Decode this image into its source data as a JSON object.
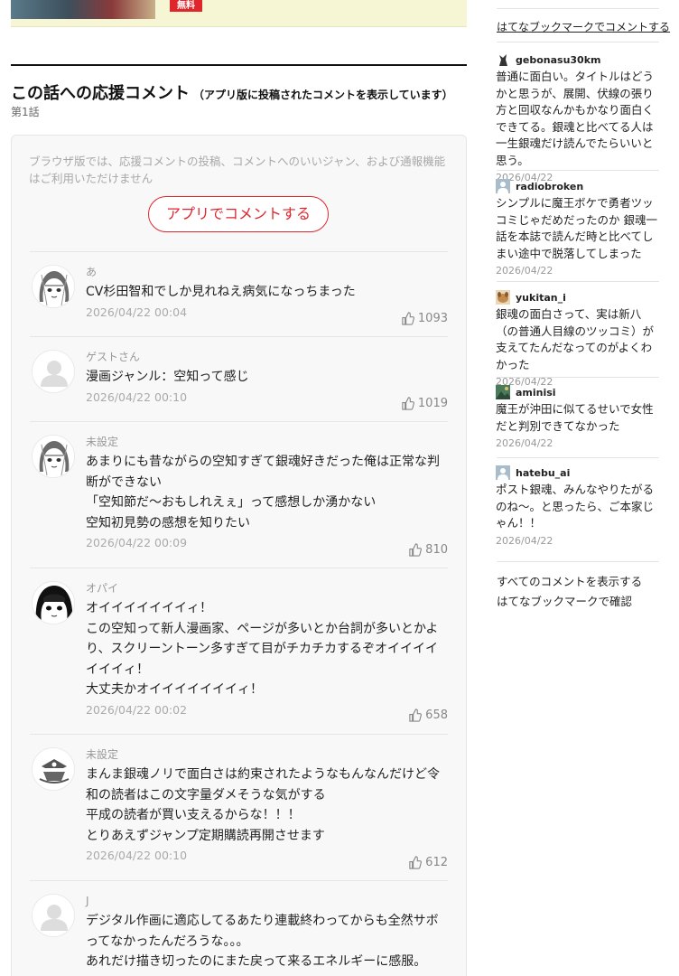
{
  "banner": {
    "free_label": "無料"
  },
  "section": {
    "title": "この話への応援コメント",
    "subtitle": "（アプリ版に投稿されたコメントを表示しています）",
    "episode": "第1話"
  },
  "notice": "ブラウザ版では、応援コメントの投稿、コメントへのいいジャン、および通報機能はご利用いただけません",
  "app_button_label": "アプリでコメントする",
  "comments": [
    {
      "name": "あ",
      "lines": [
        "CV杉田智和でしか見れねえ病気になっちまった"
      ],
      "date": "2026/04/22 00:04",
      "likes": "1093",
      "avatar": "manga-girl-avatar"
    },
    {
      "name": "ゲストさん",
      "lines": [
        "漫画ジャンル：空知って感じ"
      ],
      "date": "2026/04/22 00:10",
      "likes": "1019",
      "avatar": "default-user-avatar"
    },
    {
      "name": "未設定",
      "lines": [
        "あまりにも昔ながらの空知すぎて銀魂好きだった俺は正常な判",
        "断ができない",
        "「空知節だ～おもしれえぇ」って感想しか湧かない",
        "空知初見勢の感想を知りたい"
      ],
      "date": "2026/04/22 00:09",
      "likes": "810",
      "avatar": "manga-girl-avatar"
    },
    {
      "name": "オパイ",
      "lines": [
        "オイイイイイイイィ！",
        "この空知って新人漫画家、ページが多いとか台詞が多いとかよ",
        "り、スクリーントーン多すぎて目がチカチカするぞオイイイイ",
        "イイイィ！",
        "大丈夫かオイイイイイイイィ！"
      ],
      "date": "2026/04/22 00:02",
      "likes": "658",
      "avatar": "manga-dark-hair-avatar"
    },
    {
      "name": "未設定",
      "lines": [
        "まんま銀魂ノリで面白さは約束されたようなもんなんだけど令",
        "和の読者はこの文字量ダメそうな気がする",
        "平成の読者が買い支えるからな！！！",
        "とりあえずジャンプ定期購読再開させます"
      ],
      "date": "2026/04/22 00:10",
      "likes": "612",
      "avatar": "pirate-ship-avatar"
    },
    {
      "name": "J",
      "lines": [
        "デジタル作画に適応してるあたり連載終わってからも全然サボ",
        "ってなかったんだろうな。。。",
        "あれだけ描き切ったのにまた戻って来るエネルギーに感服。"
      ],
      "date": "",
      "likes": "",
      "avatar": "default-user-avatar"
    }
  ],
  "sidebar": {
    "hatena_comment_link": "はてなブックマークでコメントする",
    "bookmarks": [
      {
        "user": "gebonasu30km",
        "text": "普通に面白い。タイトルはどうかと思うが、展開、伏線の張り方と回収なんかもかなり面白くできてる。銀魂と比べてる人は一生銀魂だけ読んでたらいいと思う。",
        "date": "2026/04/22",
        "icon": "character-icon"
      },
      {
        "user": "radiobroken",
        "text": "シンプルに魔王ボケで勇者ツッコミじゃだめだったのか 銀魂一話を本誌で読んだ時と比べてしまい途中で脱落してしまった",
        "date": "2026/04/22",
        "icon": "default-user-icon"
      },
      {
        "user": "yukitan_i",
        "text": "銀魂の面白さって、実は新八（の普通人目線のツッコミ）が支えてたんだなってのがよくわかった",
        "date": "2026/04/22",
        "icon": "dog-icon"
      },
      {
        "user": "aminisi",
        "text": "魔王が沖田に似てるせいで女性だと判別できてなかった",
        "date": "2026/04/22",
        "icon": "landscape-icon"
      },
      {
        "user": "hatebu_ai",
        "text": "ポスト銀魂、みんなやりたがるのね～。と思ったら、ご本家じゃん！！",
        "date": "2026/04/22",
        "icon": "default-user-icon"
      }
    ],
    "show_all_label": "すべてのコメントを表示する",
    "confirm_label": "はてなブックマークで確認"
  }
}
